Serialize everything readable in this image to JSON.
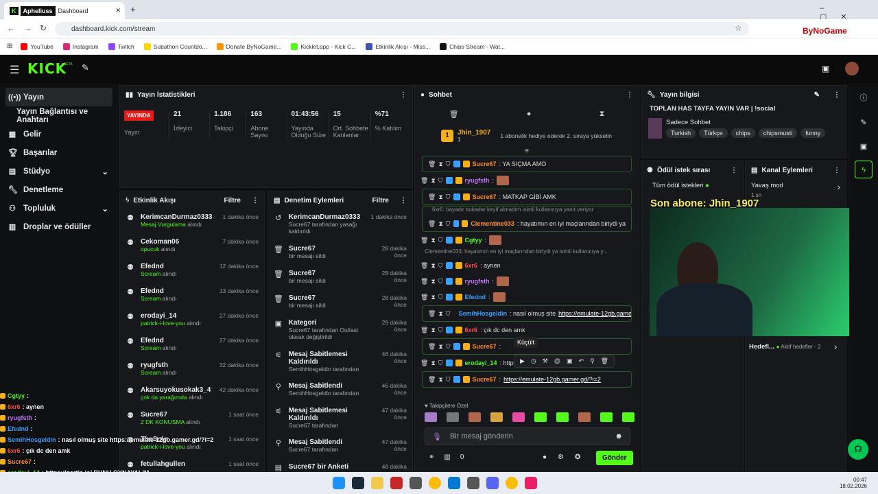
{
  "browser": {
    "tab_profile": "Apheliuss",
    "tab_title": "Dashboard",
    "url": "dashboard.kick.com/stream",
    "bookmarks": [
      "YouTube",
      "Instagram",
      "Twitch",
      "Subathon Countdo...",
      "Donate ByNoGame...",
      "Kicklet.app - Kick C...",
      "Etkinlik Akışı - Miss...",
      "Chips Stream - Wat..."
    ],
    "extension_label": "ByNoGame"
  },
  "header": {
    "logo": "KICK",
    "beta": "BETA"
  },
  "sidebar": {
    "items": [
      {
        "label": "Yayın",
        "icon": "broadcast-icon"
      },
      {
        "label": "Yayın Bağlantısı ve Anahtarı",
        "icon": ""
      },
      {
        "label": "Gelir",
        "icon": "money-icon"
      },
      {
        "label": "Başarılar",
        "icon": "trophy-icon"
      },
      {
        "label": "Stüdyo",
        "icon": "studio-icon"
      },
      {
        "label": "Denetleme",
        "icon": "wrench-icon"
      },
      {
        "label": "Topluluk",
        "icon": "community-icon"
      },
      {
        "label": "Droplar ve ödüller",
        "icon": "gift-icon"
      }
    ]
  },
  "stats": {
    "title": "Yayın İstatistikleri",
    "live_badge": "YAYINDA",
    "live_sub": "Yayın",
    "items": [
      {
        "value": "21",
        "label": "İzleyici"
      },
      {
        "value": "1.186",
        "label": "Takipçi"
      },
      {
        "value": "163",
        "label": "Abone Sayısı"
      },
      {
        "value": "01:43:56",
        "label": "Yayında Olduğu Süre"
      },
      {
        "value": "15",
        "label": "Ort. Sohbete Katılanlar"
      },
      {
        "value": "%71",
        "label": "% Katılım"
      }
    ]
  },
  "activity": {
    "title": "Etkinlik Akışı",
    "filter": "Filtre",
    "items": [
      {
        "user": "KerimcanDurmaz0333",
        "detail": "Mesaj Vurgulama",
        "suffix": "alındı",
        "time": "1 dakika önce"
      },
      {
        "user": "Cekoman06",
        "detail": "opucuk",
        "suffix": "alındı",
        "time": "7 dakika önce"
      },
      {
        "user": "Efednd",
        "detail": "Scream",
        "suffix": "alındı",
        "time": "12 dakika önce"
      },
      {
        "user": "Efednd",
        "detail": "Scream",
        "suffix": "alındı",
        "time": "13 dakika önce"
      },
      {
        "user": "erodayi_14",
        "detail": "patrick-i-love-you",
        "suffix": "alındı",
        "time": "27 dakika önce"
      },
      {
        "user": "Efednd",
        "detail": "Scream",
        "suffix": "alındı",
        "time": "27 dakika önce"
      },
      {
        "user": "ryugfsth",
        "detail": "Scream",
        "suffix": "alındı",
        "time": "32 dakika önce"
      },
      {
        "user": "Akarsuyokusokak3_4",
        "detail": "çok da yarağımda",
        "suffix": "alındı",
        "time": "42 dakika önce"
      },
      {
        "user": "Sucre67",
        "detail": "2 DK KONUSMA",
        "suffix": "alındı",
        "time": "1 saat önce"
      },
      {
        "user": "TheSolo",
        "detail": "patrick-i-love-you",
        "suffix": "alındı",
        "time": "1 saat önce"
      },
      {
        "user": "fetullahgullen",
        "detail": "",
        "suffix": "",
        "time": "1 saat önce"
      }
    ]
  },
  "moderation": {
    "title": "Denetim Eylemleri",
    "filter": "Filtre",
    "items": [
      {
        "icon": "unban-icon",
        "title": "KerimcanDurmaz0333",
        "desc": "Sucre67 tarafından yasağı kaldırıldı",
        "time": "1 dakika önce"
      },
      {
        "icon": "trash-icon",
        "title": "Sucre67",
        "desc": "bir mesajı sildi",
        "time": "28 dakika önce"
      },
      {
        "icon": "trash-icon",
        "title": "Sucre67",
        "desc": "bir mesajı sildi",
        "time": "28 dakika önce"
      },
      {
        "icon": "trash-icon",
        "title": "Sucre67",
        "desc": "bir mesajı sildi",
        "time": "28 dakika önce"
      },
      {
        "icon": "category-icon",
        "title": "Kategori",
        "desc": "Sucre67 tarafından Outlast olarak değiştirildi",
        "time": "29 dakika önce"
      },
      {
        "icon": "unpin-icon",
        "title": "Mesaj Sabitlemesi Kaldırıldı",
        "desc": "SemihHosgeldin tarafından",
        "time": "46 dakika önce"
      },
      {
        "icon": "pin-icon",
        "title": "Mesaj Sabitlendi",
        "desc": "SemihHosgeldin tarafından",
        "time": "46 dakika önce"
      },
      {
        "icon": "unpin-icon",
        "title": "Mesaj Sabitlemesi Kaldırıldı",
        "desc": "Sucre67 tarafından",
        "time": "47 dakika önce"
      },
      {
        "icon": "pin-icon",
        "title": "Mesaj Sabitlendi",
        "desc": "Sucre67 tarafından",
        "time": "47 dakika önce"
      },
      {
        "icon": "poll-icon",
        "title": "Sucre67 bir Anketi",
        "desc": "",
        "time": "48 dakika"
      }
    ]
  },
  "chat": {
    "title": "Sohbet",
    "pinned_user": "Jhin_1907",
    "pinned_count": "1",
    "pinned_msg": "1 abonelik hediye ederek 2. sıraya yükselin",
    "tooltip": "Küçült",
    "messages": [
      {
        "user": "Sucre67",
        "text": ": YA SIÇMA AMO",
        "color": "#ff8c2a",
        "boxed": true
      },
      {
        "user": "ryugfsth",
        "text": ":",
        "color": "#c678ff",
        "emote": true,
        "boxed": false
      },
      {
        "user": "Sucre67",
        "text": ": MATKAP GİBİ AMK",
        "color": "#ff8c2a",
        "boxed": true
      },
      {
        "reply": "6xr6: bayadır bukadar keyif almadım isimli kullanıcıya yanıt veriyor",
        "user": "Clementine033",
        "text": ": hayatımın en iyi maçlarından biriydi ya",
        "color": "#ff8c2a",
        "boxed": true
      },
      {
        "user": "Cgtyy",
        "text": ":",
        "color": "#53fc18",
        "emote": true,
        "boxed": false
      },
      {
        "reply": "Clementine033: hayatımın en iyi maçlarından biriydi ya isimli kullanıcıya y...",
        "user": "6xr6",
        "text": ": aynen",
        "color": "#ff4d4d",
        "boxed": false
      },
      {
        "user": "ryugfsth",
        "text": ":",
        "color": "#c678ff",
        "emote": true,
        "boxed": false
      },
      {
        "user": "Efednd",
        "text": ":",
        "color": "#3aa0ff",
        "emote": true,
        "boxed": false
      },
      {
        "user": "SemihHosgeldin",
        "text": ": nasıl olmuş site",
        "link": "https://emulate-12gb.gamer.gd/?i=2",
        "color": "#3aa0ff",
        "boxed": true
      },
      {
        "user": "6xr6",
        "text": ": çık dc den amk",
        "color": "#ff4d4d",
        "boxed": false
      },
      {
        "user": "Sucre67",
        "text": ":",
        "color": "#ff8c2a",
        "boxed": true
      },
      {
        "user": "erodayi_14",
        "text": ": https://gartic.io/ BUNU OYNAYALIM",
        "color": "#53fc18",
        "boxed": false
      },
      {
        "user": "Sucre67",
        "text": ":",
        "link": "https://emulate-12gb.gamer.gd/?i=2",
        "color": "#ff8c2a",
        "boxed": true
      }
    ],
    "followers_only": "Takipçilere Özel",
    "input_placeholder": "Bir mesaj gönderin",
    "points": "0",
    "send": "Gönder"
  },
  "stream_info": {
    "title": "Yayın bilgisi",
    "stream_title": "TOPLAN HAS TAYFA YAYIN VAR | !social",
    "category": "Sadece Sohbet",
    "tags": [
      "Turkish",
      "Türkçe",
      "chips",
      "chipsmusti",
      "funny"
    ]
  },
  "rewards": {
    "title": "Ödül istek sırası",
    "all": "Tüm ödül istekleri"
  },
  "channel": {
    "title": "Kanal Eylemleri",
    "slow": "Yavaş mod",
    "slow_sub": "1 sn",
    "goals": "Hedefl...",
    "goals_sub": "Aktif hedefler - 2"
  },
  "overlay": {
    "sub_alert": "Son abone: Jhin_1907",
    "lines": [
      {
        "user": "Cgtyy",
        "text": " :",
        "color": "#53fc18"
      },
      {
        "user": "6xr6",
        "text": " : aynen",
        "color": "#ff4d4d"
      },
      {
        "user": "ryugfsth",
        "text": " :",
        "color": "#c678ff"
      },
      {
        "user": "Efednd",
        "text": " :",
        "color": "#3aa0ff"
      },
      {
        "user": "SemihHosgeldin",
        "text": " : nasıl olmuş site https://emulate-12gb.gamer.gd/?i=2",
        "color": "#3aa0ff"
      },
      {
        "user": "6xr6",
        "text": " : çık dc den amk",
        "color": "#ff4d4d"
      },
      {
        "user": "Sucre67",
        "text": " :",
        "color": "#ff8c2a"
      },
      {
        "user": "erodayi_14",
        "text": " : https://gartic.io/ BUNU OYNAYALIM",
        "color": "#53fc18"
      },
      {
        "user": "Sucre67",
        "text": " : https://emulate-12gb.gamer.gd/?i=2",
        "color": "#ff8c2a"
      }
    ]
  },
  "taskbar": {
    "time": "00:47",
    "date": "18.02.2026"
  }
}
